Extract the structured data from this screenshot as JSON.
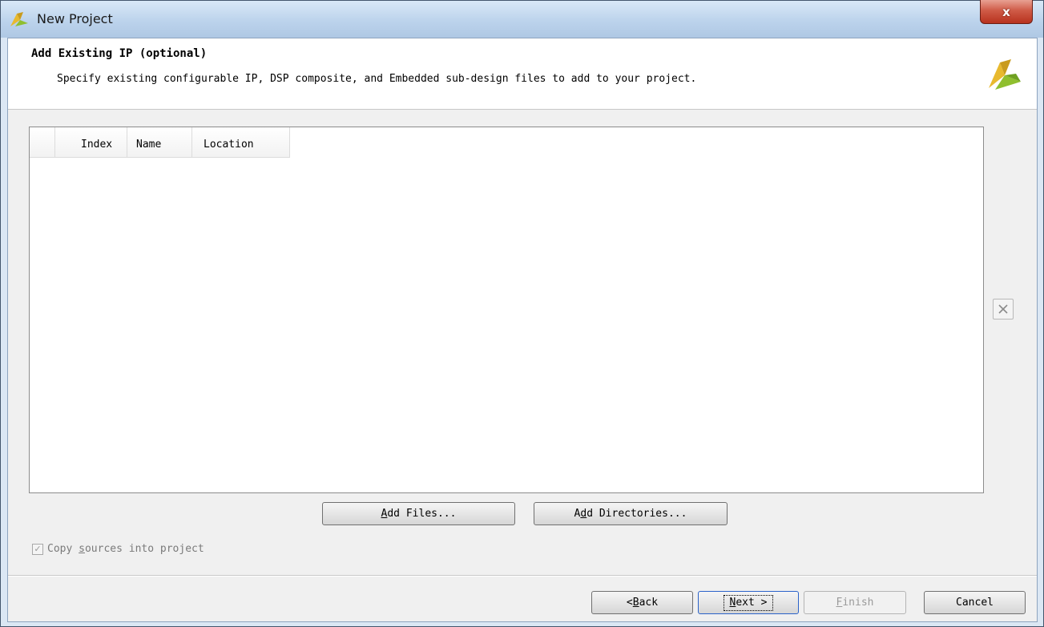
{
  "window": {
    "title": "New Project",
    "close_label": "x"
  },
  "header": {
    "title": "Add Existing IP (optional)",
    "description": "Specify existing configurable IP, DSP composite, and Embedded sub-design files to add to your project."
  },
  "table": {
    "columns": [
      "",
      "Index",
      "Name",
      "Location"
    ],
    "rows": []
  },
  "buttons": {
    "add_files": {
      "mnemonic": "A",
      "rest": "dd Files..."
    },
    "add_directories": {
      "pre": "A",
      "mnemonic": "d",
      "rest": "d Directories..."
    },
    "back": {
      "pre": "< ",
      "mnemonic": "B",
      "rest": "ack"
    },
    "next": {
      "mnemonic": "N",
      "rest": "ext >"
    },
    "finish": {
      "mnemonic": "F",
      "rest": "inish"
    },
    "cancel": "Cancel"
  },
  "copy_sources": {
    "checked": true,
    "label_pre": "Copy ",
    "label_mnemonic": "s",
    "label_rest": "ources into project"
  },
  "colors": {
    "logo_gold": "#e8b92e",
    "logo_green": "#8fbf2f",
    "next_focus_border": "#2a62c9"
  }
}
